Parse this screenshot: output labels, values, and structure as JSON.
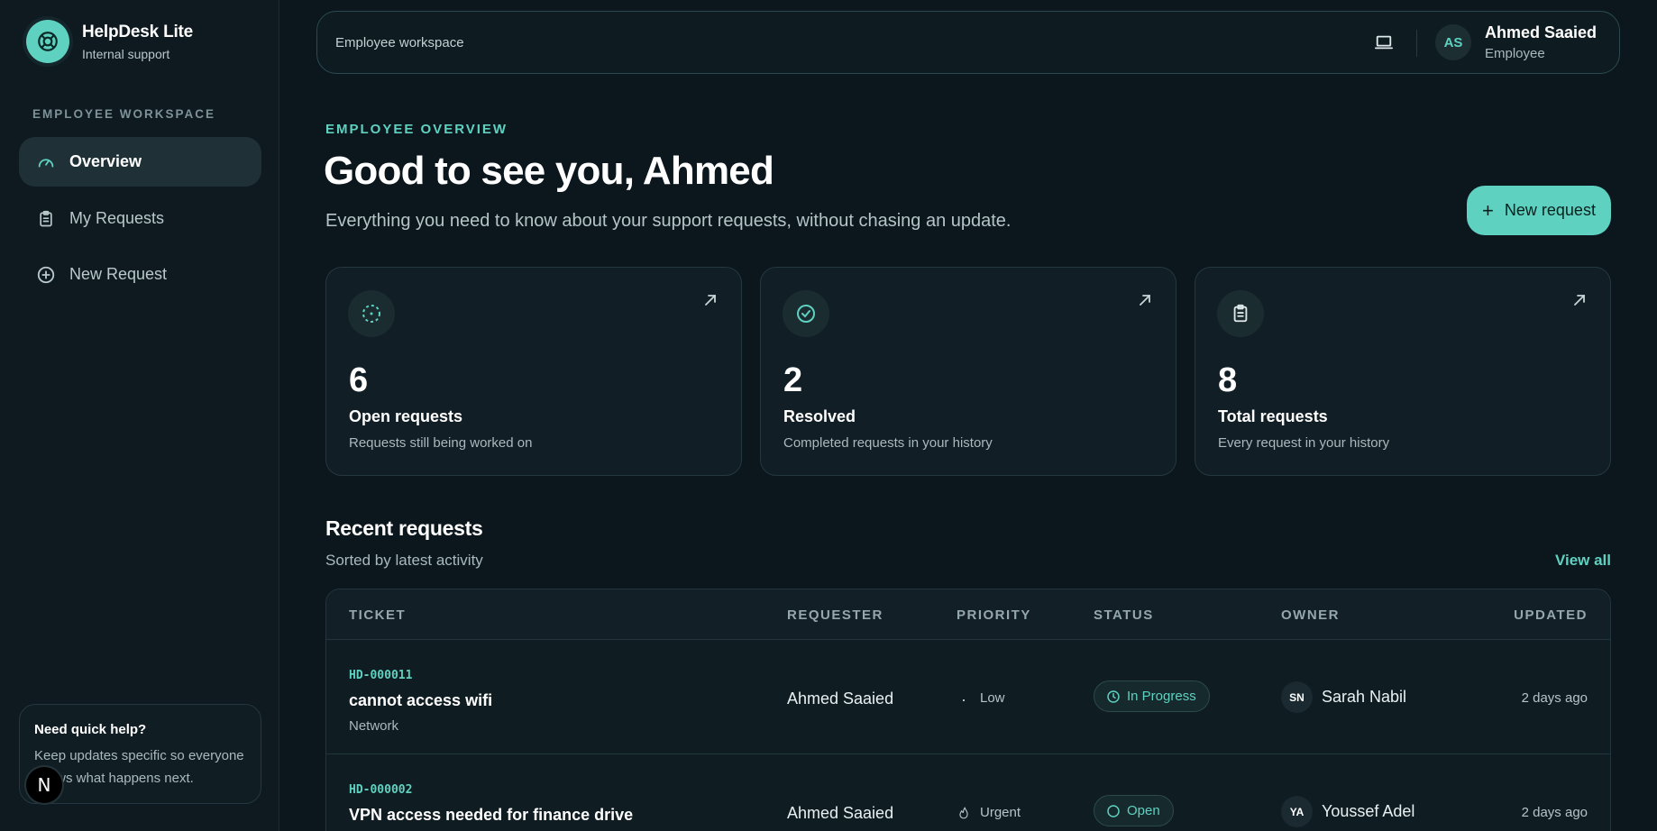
{
  "brand": {
    "name": "HelpDesk Lite",
    "subtitle": "Internal support"
  },
  "sidebar": {
    "section_label": "EMPLOYEE WORKSPACE",
    "items": [
      {
        "label": "Overview",
        "icon": "gauge-icon",
        "active": true
      },
      {
        "label": "My Requests",
        "icon": "clipboard-icon",
        "active": false
      },
      {
        "label": "New Request",
        "icon": "plus-circle-icon",
        "active": false
      }
    ],
    "help": {
      "title": "Need quick help?",
      "body": "Keep updates specific so everyone knows what happens next."
    },
    "badge": "N"
  },
  "topbar": {
    "label": "Employee workspace",
    "user": {
      "initials": "AS",
      "name": "Ahmed Saaied",
      "role": "Employee"
    }
  },
  "header": {
    "eyebrow": "EMPLOYEE OVERVIEW",
    "title": "Good to see you, Ahmed",
    "subtitle": "Everything you need to know about your support requests, without chasing an update.",
    "new_request_label": "New request"
  },
  "stats": [
    {
      "value": "6",
      "label": "Open requests",
      "desc": "Requests still being worked on",
      "icon": "dashed-circle-icon"
    },
    {
      "value": "2",
      "label": "Resolved",
      "desc": "Completed requests in your history",
      "icon": "check-circle-icon"
    },
    {
      "value": "8",
      "label": "Total requests",
      "desc": "Every request in your history",
      "icon": "clipboard-icon"
    }
  ],
  "recent": {
    "title": "Recent requests",
    "subtitle": "Sorted by latest activity",
    "view_all": "View all",
    "columns": [
      "TICKET",
      "REQUESTER",
      "PRIORITY",
      "STATUS",
      "OWNER",
      "UPDATED"
    ],
    "rows": [
      {
        "id": "HD-000011",
        "title": "cannot access wifi",
        "category": "Network",
        "requester": "Ahmed Saaied",
        "priority": "Low",
        "status": "In Progress",
        "owner_initials": "SN",
        "owner": "Sarah Nabil",
        "updated": "2 days ago"
      },
      {
        "id": "HD-000002",
        "title": "VPN access needed for finance drive",
        "category": "",
        "requester": "Ahmed Saaied",
        "priority": "Urgent",
        "status": "Open",
        "owner_initials": "YA",
        "owner": "Youssef Adel",
        "updated": "2 days ago"
      }
    ]
  },
  "colors": {
    "accent": "#5fd1c0",
    "background": "#0b171d",
    "sidebar": "#0e1a20"
  }
}
